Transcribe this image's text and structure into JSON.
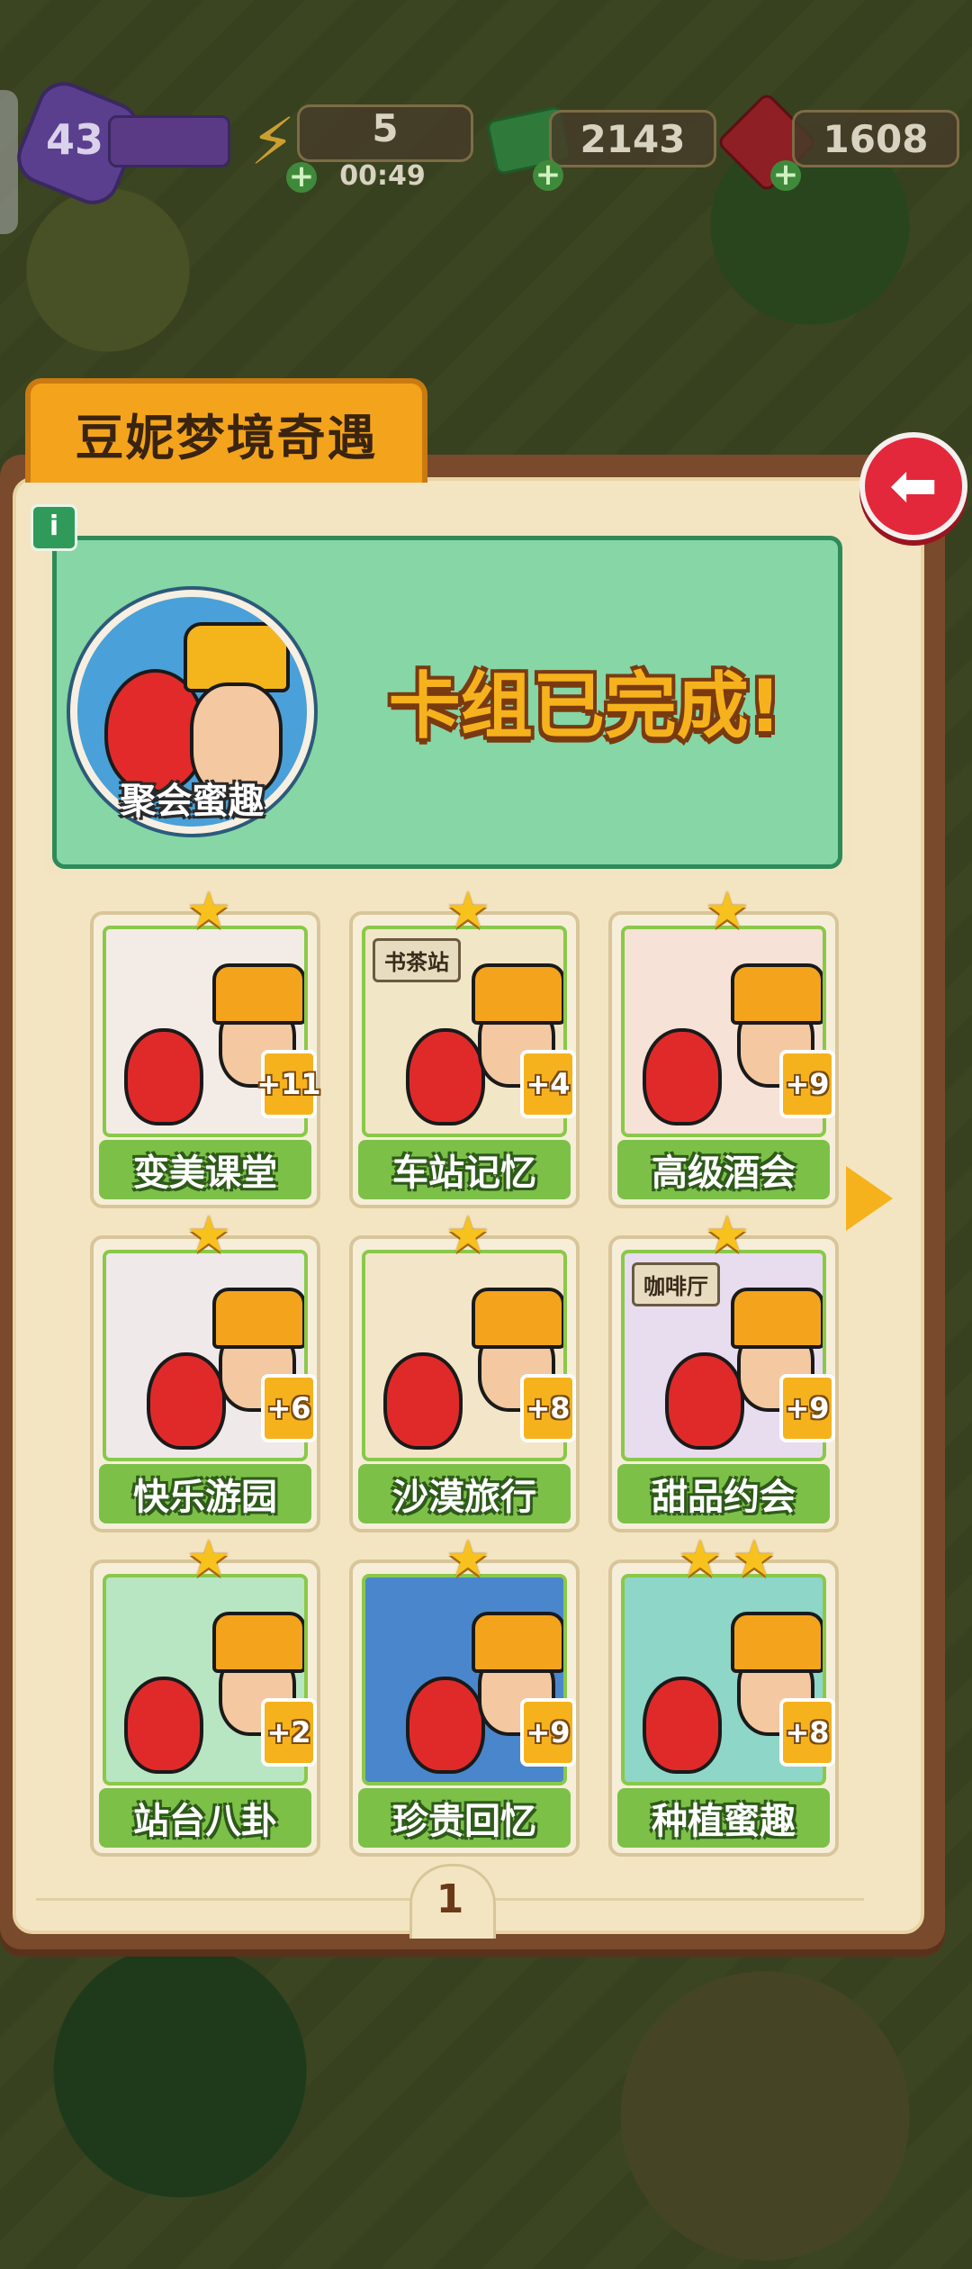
{
  "hud": {
    "level": "43",
    "energy": "5",
    "energy_timer": "00:49",
    "cash": "2143",
    "gems": "1608"
  },
  "panel": {
    "title": "豆妮梦境奇遇",
    "deck_name": "聚会蜜趣",
    "deck_status": "卡组已完成!",
    "page": "1"
  },
  "cards": [
    {
      "label": "变美课堂",
      "badge": "+11",
      "art": "#f3ece6"
    },
    {
      "label": "车站记忆",
      "badge": "+4",
      "art": "#f1e6c6",
      "sign": "书茶站"
    },
    {
      "label": "高级酒会",
      "badge": "+9",
      "art": "#f6e2d6"
    },
    {
      "label": "快乐游园",
      "badge": "+6",
      "art": "#efe9ea"
    },
    {
      "label": "沙漠旅行",
      "badge": "+8",
      "art": "#f3e6c8"
    },
    {
      "label": "甜品约会",
      "badge": "+9",
      "art": "#e8dcef",
      "sign": "咖啡厅"
    },
    {
      "label": "站台八卦",
      "badge": "+2",
      "art": "#b8e6c2"
    },
    {
      "label": "珍贵回忆",
      "badge": "+9",
      "art": "#4a86cc"
    },
    {
      "label": "种植蜜趣",
      "badge": "+8",
      "art": "#8ed6c8"
    }
  ],
  "colors": {
    "accent": "#f6b21c",
    "card_label": "#7cc048",
    "banner": "#86d6a6",
    "close": "#e2283a"
  }
}
